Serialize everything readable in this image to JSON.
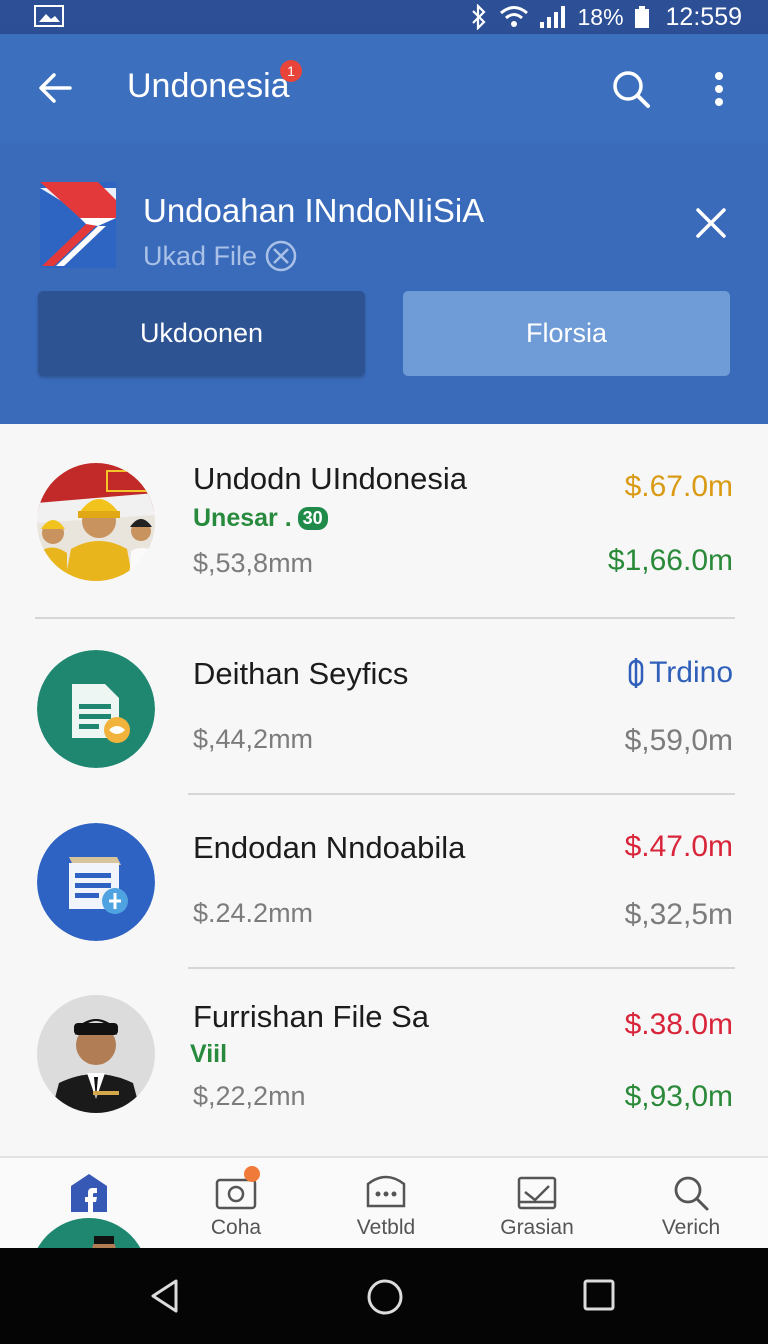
{
  "status_bar": {
    "battery_pct": "18%",
    "time": "12:559",
    "icons": [
      "gallery-icon",
      "bluetooth-icon",
      "wifi-icon",
      "signal-icon",
      "battery-icon"
    ]
  },
  "app_bar": {
    "title": "Undonesia",
    "badge": "1"
  },
  "banner": {
    "title": "Undoahan INndoNIiSiA",
    "subtitle": "Ukad File",
    "button_primary": "Ukdoonen",
    "button_secondary": "Florsia"
  },
  "rows": [
    {
      "name": "Undodn UIndonesia",
      "tag": "Unesar .",
      "tag_badge": "30",
      "sub": "$,53,8mm",
      "right_top": "$.67.0m",
      "right_top_color": "#d99a14",
      "right_bottom": "$1,66.0m",
      "right_bottom_color": "#2a8a3a"
    },
    {
      "name": "Deithan Seyfics",
      "sub": "$,44,2mm",
      "right_top": "Trdino",
      "right_top_color": "#2f5fb8",
      "right_bottom": "$,59,0m",
      "right_bottom_color": "#7c7c7c"
    },
    {
      "name": "Endodan Nndoabila",
      "sub": "$.24.2mm",
      "right_top": "$.47.0m",
      "right_top_color": "#d9253a",
      "right_bottom": "$,32,5m",
      "right_bottom_color": "#7c7c7c"
    },
    {
      "name": "Furrishan File Sa",
      "tag": "Viil",
      "sub": "$,22,2mn",
      "right_top": "$.38.0m",
      "right_top_color": "#d9253a",
      "right_bottom": "$,93,0m",
      "right_bottom_color": "#2a8a3a"
    }
  ],
  "bottom_nav": {
    "items": [
      {
        "label": "",
        "icon": "facebook-icon"
      },
      {
        "label": "Coha",
        "icon": "camera-icon"
      },
      {
        "label": "Vetbld",
        "icon": "chat-icon"
      },
      {
        "label": "Grasian",
        "icon": "inbox-icon"
      },
      {
        "label": "Verich",
        "icon": "search-icon"
      }
    ]
  }
}
